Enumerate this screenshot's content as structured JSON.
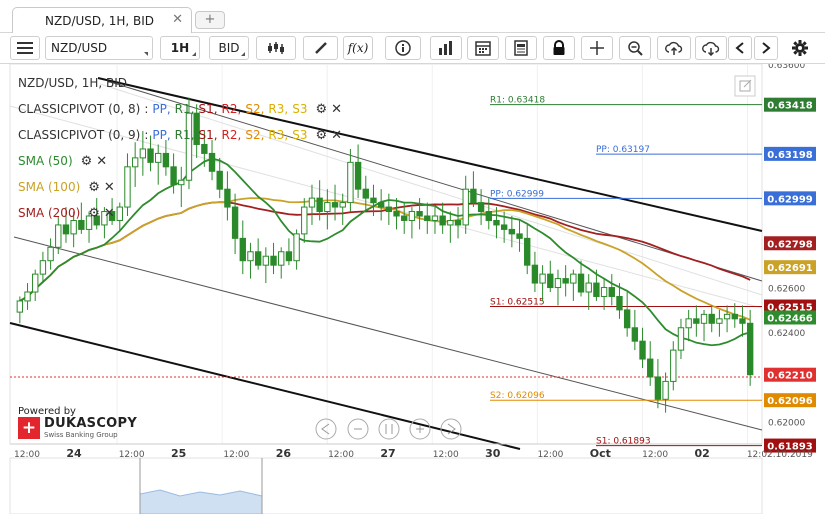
{
  "tabbar": {
    "title": "NZD/USD, 1H, BID",
    "new_tab": "+"
  },
  "toolbar": {
    "symbol": "NZD/USD",
    "period": "1H",
    "side": "BID",
    "fx_label": "f(x)",
    "buttons": [
      {
        "name": "bar-style-icon"
      },
      {
        "name": "draw-pencil-icon"
      },
      {
        "name": "indicators-fx-icon"
      },
      {
        "name": "info-icon"
      },
      {
        "name": "volume-chart-icon"
      },
      {
        "name": "calendar-icon"
      },
      {
        "name": "news-sheet-icon"
      },
      {
        "name": "lock-icon"
      },
      {
        "name": "crosshair-icon"
      },
      {
        "name": "zoom-icon"
      },
      {
        "name": "cloud-upload-icon"
      },
      {
        "name": "cloud-download-icon"
      },
      {
        "name": "chevron-left-icon"
      },
      {
        "name": "chevron-right-icon"
      },
      {
        "name": "gear-icon"
      }
    ]
  },
  "legend": {
    "instrument": "NZD/USD, 1H, BID",
    "pivot1": {
      "name": "CLASSICPIVOT (0, 8)",
      "tokens": [
        "PP,",
        "R1,",
        "S1,",
        "R2,",
        "S2,",
        "R3,",
        "S3"
      ]
    },
    "pivot2": {
      "name": "CLASSICPIVOT (0, 9)",
      "tokens": [
        "PP,",
        "R1,",
        "S1,",
        "R2,",
        "S2,",
        "R3,",
        "S3"
      ]
    },
    "sma50": "SMA (50)",
    "sma100": "SMA (100)",
    "sma200": "SMA (200)",
    "colon": ":"
  },
  "branding": {
    "powered_by": "Powered by",
    "name": "DUKASCOPY",
    "sub": "Swiss Banking Group",
    "cross": "+"
  },
  "colors": {
    "sma50": "#2e8b2e",
    "sma100": "#c9a227",
    "sma200": "#a32020",
    "pp": "#3a6fd8",
    "r1": "#2e7d32",
    "s1": "#a01010",
    "s2": "#e08a00",
    "r2": "#d62020",
    "r3": "#d9b000",
    "s3": "#d9b000",
    "candle": "#2a8a2a",
    "last": "#e03030"
  },
  "chart_data": {
    "type": "candlestick",
    "symbol": "NZD/USD",
    "timeframe": "1H",
    "price_range": [
      0.619,
      0.636
    ],
    "y_ticks": [
      "0.63600",
      "0.62600",
      "0.62400",
      "0.62000"
    ],
    "x_ticks": [
      "12:00",
      "24",
      "12:00",
      "25",
      "12:00",
      "26",
      "12:00",
      "27",
      "12:00",
      "30",
      "12:00",
      "Oct",
      "12:00",
      "02",
      "12:02.10.2019"
    ],
    "price_labels": [
      {
        "value": "0.63418",
        "color": "#2e7d32"
      },
      {
        "value": "0.63198",
        "color": "#3a6fd8"
      },
      {
        "value": "0.62999",
        "color": "#3a6fd8"
      },
      {
        "value": "0.62798",
        "color": "#a32020"
      },
      {
        "value": "0.62691",
        "color": "#c9a227"
      },
      {
        "value": "0.62515",
        "color": "#a01010"
      },
      {
        "value": "0.62466",
        "color": "#2e8b2e"
      },
      {
        "value": "0.62210",
        "color": "#e03030"
      },
      {
        "value": "0.62096",
        "color": "#e08a00"
      },
      {
        "value": "0.61893",
        "color": "#a01010"
      }
    ],
    "pivots": [
      {
        "label": "R1: 0.63418",
        "price": 0.63418,
        "color": "#2e7d32",
        "from": "Sep 27 00:00",
        "to": "now"
      },
      {
        "label": "PP: 0.63197",
        "price": 0.63197,
        "color": "#3a6fd8",
        "from": "Oct 01 00:00",
        "to": "now"
      },
      {
        "label": "PP: 0.62999",
        "price": 0.62999,
        "color": "#3a6fd8",
        "from": "Sep 27 00:00",
        "to": "now"
      },
      {
        "label": "S1: 0.62515",
        "price": 0.62515,
        "color": "#a01010",
        "from": "Sep 27 00:00",
        "to": "now"
      },
      {
        "label": "S2: 0.62096",
        "price": 0.62096,
        "color": "#e08a00",
        "from": "Sep 27 00:00",
        "to": "now"
      },
      {
        "label": "S1: 0.61893",
        "price": 0.61893,
        "color": "#a01010",
        "from": "Oct 01 00:00",
        "to": "now"
      }
    ],
    "candles": [
      [
        0.6249,
        0.6256,
        0.6244,
        0.6254
      ],
      [
        0.6254,
        0.6262,
        0.625,
        0.6258
      ],
      [
        0.6258,
        0.6268,
        0.6254,
        0.6266
      ],
      [
        0.6266,
        0.6276,
        0.6262,
        0.6272
      ],
      [
        0.6272,
        0.6282,
        0.6268,
        0.6278
      ],
      [
        0.6278,
        0.6292,
        0.6275,
        0.6288
      ],
      [
        0.6288,
        0.6296,
        0.628,
        0.6284
      ],
      [
        0.6284,
        0.6294,
        0.6278,
        0.629
      ],
      [
        0.629,
        0.6298,
        0.6284,
        0.6286
      ],
      [
        0.6286,
        0.6294,
        0.628,
        0.6292
      ],
      [
        0.6292,
        0.63,
        0.6286,
        0.6288
      ],
      [
        0.6288,
        0.6296,
        0.6282,
        0.6294
      ],
      [
        0.6294,
        0.63,
        0.6288,
        0.629
      ],
      [
        0.629,
        0.6298,
        0.6285,
        0.6296
      ],
      [
        0.6296,
        0.632,
        0.6292,
        0.6314
      ],
      [
        0.6314,
        0.6325,
        0.6305,
        0.6318
      ],
      [
        0.6318,
        0.633,
        0.631,
        0.6322
      ],
      [
        0.6322,
        0.6328,
        0.6312,
        0.6316
      ],
      [
        0.6316,
        0.6324,
        0.6306,
        0.632
      ],
      [
        0.632,
        0.6326,
        0.631,
        0.6314
      ],
      [
        0.6314,
        0.632,
        0.6302,
        0.6306
      ],
      [
        0.6306,
        0.6314,
        0.6296,
        0.6308
      ],
      [
        0.6308,
        0.6345,
        0.6304,
        0.6338
      ],
      [
        0.6338,
        0.6342,
        0.6318,
        0.6324
      ],
      [
        0.6324,
        0.633,
        0.6314,
        0.632
      ],
      [
        0.632,
        0.6326,
        0.6308,
        0.6312
      ],
      [
        0.6312,
        0.6318,
        0.63,
        0.6304
      ],
      [
        0.6304,
        0.6312,
        0.629,
        0.6296
      ],
      [
        0.6296,
        0.6302,
        0.6275,
        0.6282
      ],
      [
        0.6282,
        0.629,
        0.6266,
        0.6272
      ],
      [
        0.6272,
        0.628,
        0.6264,
        0.6276
      ],
      [
        0.6276,
        0.6282,
        0.6268,
        0.627
      ],
      [
        0.627,
        0.6278,
        0.6262,
        0.6274
      ],
      [
        0.6274,
        0.628,
        0.6266,
        0.627
      ],
      [
        0.627,
        0.6278,
        0.6264,
        0.6276
      ],
      [
        0.6276,
        0.6282,
        0.627,
        0.6272
      ],
      [
        0.6272,
        0.6286,
        0.6268,
        0.6284
      ],
      [
        0.6284,
        0.63,
        0.628,
        0.6296
      ],
      [
        0.6296,
        0.6306,
        0.6288,
        0.63
      ],
      [
        0.63,
        0.6308,
        0.629,
        0.6294
      ],
      [
        0.6294,
        0.6304,
        0.6286,
        0.6298
      ],
      [
        0.6298,
        0.6306,
        0.629,
        0.6296
      ],
      [
        0.6296,
        0.6302,
        0.6288,
        0.6298
      ],
      [
        0.6298,
        0.6322,
        0.6294,
        0.6316
      ],
      [
        0.6316,
        0.6324,
        0.63,
        0.6304
      ],
      [
        0.6304,
        0.631,
        0.6294,
        0.63
      ],
      [
        0.63,
        0.6306,
        0.6292,
        0.6298
      ],
      [
        0.6298,
        0.6304,
        0.629,
        0.6296
      ],
      [
        0.6296,
        0.6302,
        0.6288,
        0.6294
      ],
      [
        0.6294,
        0.63,
        0.6286,
        0.6292
      ],
      [
        0.6292,
        0.6298,
        0.6284,
        0.629
      ],
      [
        0.629,
        0.6296,
        0.6282,
        0.6294
      ],
      [
        0.6294,
        0.63,
        0.6286,
        0.6292
      ],
      [
        0.6292,
        0.6298,
        0.6284,
        0.629
      ],
      [
        0.629,
        0.6296,
        0.6284,
        0.6292
      ],
      [
        0.6292,
        0.6298,
        0.6284,
        0.6288
      ],
      [
        0.6288,
        0.6294,
        0.628,
        0.629
      ],
      [
        0.629,
        0.6296,
        0.6282,
        0.6288
      ],
      [
        0.6288,
        0.631,
        0.6284,
        0.6304
      ],
      [
        0.6304,
        0.6312,
        0.6296,
        0.6298
      ],
      [
        0.6298,
        0.6304,
        0.6288,
        0.6294
      ],
      [
        0.6294,
        0.63,
        0.6286,
        0.629
      ],
      [
        0.629,
        0.6296,
        0.6282,
        0.6288
      ],
      [
        0.6288,
        0.6294,
        0.628,
        0.6286
      ],
      [
        0.6286,
        0.6292,
        0.6278,
        0.6284
      ],
      [
        0.6284,
        0.629,
        0.6276,
        0.6282
      ],
      [
        0.6282,
        0.6288,
        0.6266,
        0.627
      ],
      [
        0.627,
        0.6276,
        0.6258,
        0.6262
      ],
      [
        0.6262,
        0.627,
        0.6254,
        0.6266
      ],
      [
        0.6266,
        0.6272,
        0.6258,
        0.626
      ],
      [
        0.626,
        0.6268,
        0.6252,
        0.6264
      ],
      [
        0.6264,
        0.627,
        0.6256,
        0.6262
      ],
      [
        0.6262,
        0.6268,
        0.6254,
        0.6266
      ],
      [
        0.6266,
        0.6272,
        0.6256,
        0.6258
      ],
      [
        0.6258,
        0.6266,
        0.625,
        0.6262
      ],
      [
        0.6262,
        0.6268,
        0.6254,
        0.6256
      ],
      [
        0.6256,
        0.6264,
        0.625,
        0.626
      ],
      [
        0.626,
        0.6266,
        0.6252,
        0.6256
      ],
      [
        0.6256,
        0.6262,
        0.6246,
        0.625
      ],
      [
        0.625,
        0.6258,
        0.6238,
        0.6242
      ],
      [
        0.6242,
        0.625,
        0.6232,
        0.6236
      ],
      [
        0.6236,
        0.6242,
        0.6224,
        0.6228
      ],
      [
        0.6228,
        0.6236,
        0.6216,
        0.622
      ],
      [
        0.622,
        0.6228,
        0.6206,
        0.621
      ],
      [
        0.621,
        0.6222,
        0.6204,
        0.6218
      ],
      [
        0.6218,
        0.6236,
        0.6214,
        0.6232
      ],
      [
        0.6232,
        0.6246,
        0.6228,
        0.6242
      ],
      [
        0.6242,
        0.625,
        0.6236,
        0.6246
      ],
      [
        0.6246,
        0.6252,
        0.6238,
        0.6244
      ],
      [
        0.6244,
        0.625,
        0.6236,
        0.6248
      ],
      [
        0.6248,
        0.6252,
        0.624,
        0.6244
      ],
      [
        0.6244,
        0.625,
        0.6238,
        0.6246
      ],
      [
        0.6246,
        0.6252,
        0.624,
        0.6248
      ],
      [
        0.6248,
        0.6253,
        0.6242,
        0.6246
      ],
      [
        0.6246,
        0.6252,
        0.6238,
        0.6244
      ],
      [
        0.6244,
        0.625,
        0.6216,
        0.6221
      ]
    ]
  }
}
